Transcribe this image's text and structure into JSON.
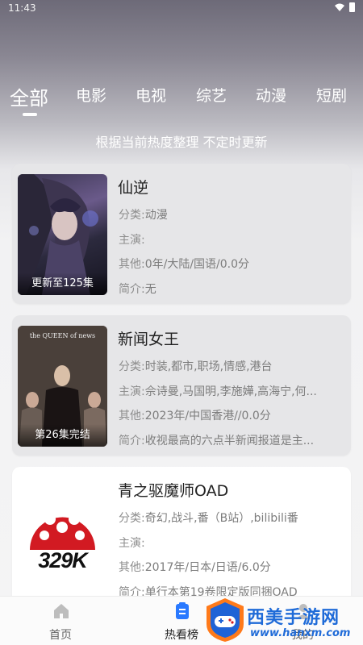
{
  "status": {
    "time": "11:43"
  },
  "tabs": [
    {
      "label": "全部"
    },
    {
      "label": "电影"
    },
    {
      "label": "电视"
    },
    {
      "label": "综艺"
    },
    {
      "label": "动漫"
    },
    {
      "label": "短剧"
    }
  ],
  "subtitle": "根据当前热度整理 不定时更新",
  "cards": [
    {
      "title": "仙逆",
      "badge": "更新至125集",
      "category_label": "分类:",
      "category": "动漫",
      "cast_label": "主演:",
      "cast": "",
      "other_label": "其他:",
      "other": "0年/大陆/国语/0.0分",
      "intro_label": "简介:",
      "intro": "无"
    },
    {
      "title": "新闻女王",
      "badge": "第26集完结",
      "poster_text": "the QUEEN of news",
      "category_label": "分类:",
      "category": "时装,都市,职场,情感,港台",
      "cast_label": "主演:",
      "cast": "佘诗曼,马国明,李施嬅,高海宁,何...",
      "other_label": "其他:",
      "other": "2023年/中国香港//0.0分",
      "intro_label": "简介:",
      "intro": "收视最高的六点半新闻报道是主..."
    },
    {
      "title": "青之驱魔师OAD",
      "poster_text": "329K",
      "category_label": "分类:",
      "category": "奇幻,战斗,番（B站）,bilibili番",
      "cast_label": "主演:",
      "cast": "",
      "other_label": "其他:",
      "other": "2017年/日本/日语/6.0分",
      "intro_label": "简介:",
      "intro": "单行本第19卷限定版同捆OAD"
    }
  ],
  "nav": [
    {
      "label": "首页"
    },
    {
      "label": "热看榜"
    },
    {
      "label": "我的"
    }
  ],
  "watermark": {
    "title": "西美手游网",
    "url": "www.hanxm.com"
  }
}
